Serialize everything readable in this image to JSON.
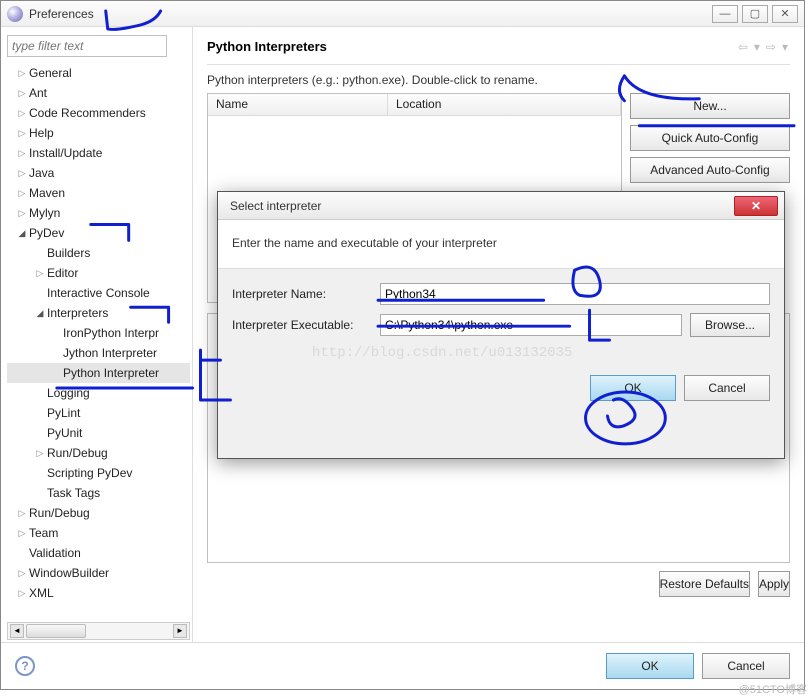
{
  "window": {
    "title": "Preferences"
  },
  "sidebar": {
    "filter_placeholder": "type filter text",
    "items": [
      {
        "label": "General",
        "indent": 0,
        "tri": "▷"
      },
      {
        "label": "Ant",
        "indent": 0,
        "tri": "▷"
      },
      {
        "label": "Code Recommenders",
        "indent": 0,
        "tri": "▷"
      },
      {
        "label": "Help",
        "indent": 0,
        "tri": "▷"
      },
      {
        "label": "Install/Update",
        "indent": 0,
        "tri": "▷"
      },
      {
        "label": "Java",
        "indent": 0,
        "tri": "▷"
      },
      {
        "label": "Maven",
        "indent": 0,
        "tri": "▷"
      },
      {
        "label": "Mylyn",
        "indent": 0,
        "tri": "▷"
      },
      {
        "label": "PyDev",
        "indent": 0,
        "tri": "◢"
      },
      {
        "label": "Builders",
        "indent": 1,
        "tri": ""
      },
      {
        "label": "Editor",
        "indent": 1,
        "tri": "▷"
      },
      {
        "label": "Interactive Console",
        "indent": 1,
        "tri": ""
      },
      {
        "label": "Interpreters",
        "indent": 1,
        "tri": "◢"
      },
      {
        "label": "IronPython Interpr",
        "indent": 2,
        "tri": ""
      },
      {
        "label": "Jython Interpreter",
        "indent": 2,
        "tri": ""
      },
      {
        "label": "Python Interpreter",
        "indent": 2,
        "tri": "",
        "selected": true
      },
      {
        "label": "Logging",
        "indent": 1,
        "tri": ""
      },
      {
        "label": "PyLint",
        "indent": 1,
        "tri": ""
      },
      {
        "label": "PyUnit",
        "indent": 1,
        "tri": ""
      },
      {
        "label": "Run/Debug",
        "indent": 1,
        "tri": "▷"
      },
      {
        "label": "Scripting PyDev",
        "indent": 1,
        "tri": ""
      },
      {
        "label": "Task Tags",
        "indent": 1,
        "tri": ""
      },
      {
        "label": "Run/Debug",
        "indent": 0,
        "tri": "▷"
      },
      {
        "label": "Team",
        "indent": 0,
        "tri": "▷"
      },
      {
        "label": "Validation",
        "indent": 0,
        "tri": ""
      },
      {
        "label": "WindowBuilder",
        "indent": 0,
        "tri": "▷"
      },
      {
        "label": "XML",
        "indent": 0,
        "tri": "▷"
      }
    ]
  },
  "right": {
    "title": "Python Interpreters",
    "description": "Python interpreters (e.g.: python.exe).   Double-click to rename.",
    "columns": {
      "name": "Name",
      "location": "Location"
    },
    "buttons": {
      "new": "New...",
      "quick": "Quick Auto-Config",
      "advanced": "Advanced Auto-Config",
      "restore": "Restore Defaults",
      "apply": "Apply"
    }
  },
  "footer": {
    "ok": "OK",
    "cancel": "Cancel"
  },
  "modal": {
    "title": "Select interpreter",
    "instruction": "Enter the name and executable of your interpreter",
    "name_label": "Interpreter Name:",
    "name_value": "Python34",
    "exec_label": "Interpreter Executable:",
    "exec_value": "C:\\Python34\\python.exe",
    "browse": "Browse...",
    "watermark": "http://blog.csdn.net/u013132035",
    "ok": "OK",
    "cancel": "Cancel"
  },
  "copyright": "@51CTO博客"
}
